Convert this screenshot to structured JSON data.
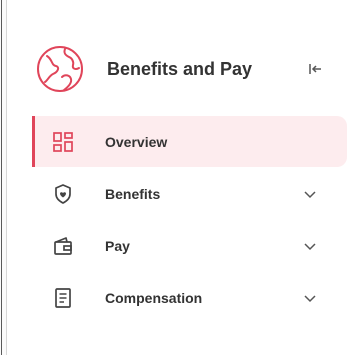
{
  "header": {
    "title": "Benefits and Pay",
    "logo_icon": "globe-icon",
    "collapse_icon": "collapse-sidebar-icon"
  },
  "nav": {
    "items": [
      {
        "label": "Overview",
        "icon": "dashboard-icon",
        "active": true,
        "expandable": false
      },
      {
        "label": "Benefits",
        "icon": "shield-heart-icon",
        "active": false,
        "expandable": true
      },
      {
        "label": "Pay",
        "icon": "wallet-icon",
        "active": false,
        "expandable": true
      },
      {
        "label": "Compensation",
        "icon": "document-icon",
        "active": false,
        "expandable": true
      }
    ]
  },
  "colors": {
    "accent": "#e0455a",
    "active_background": "#fdecee",
    "text": "#333333",
    "icon": "#444444"
  }
}
